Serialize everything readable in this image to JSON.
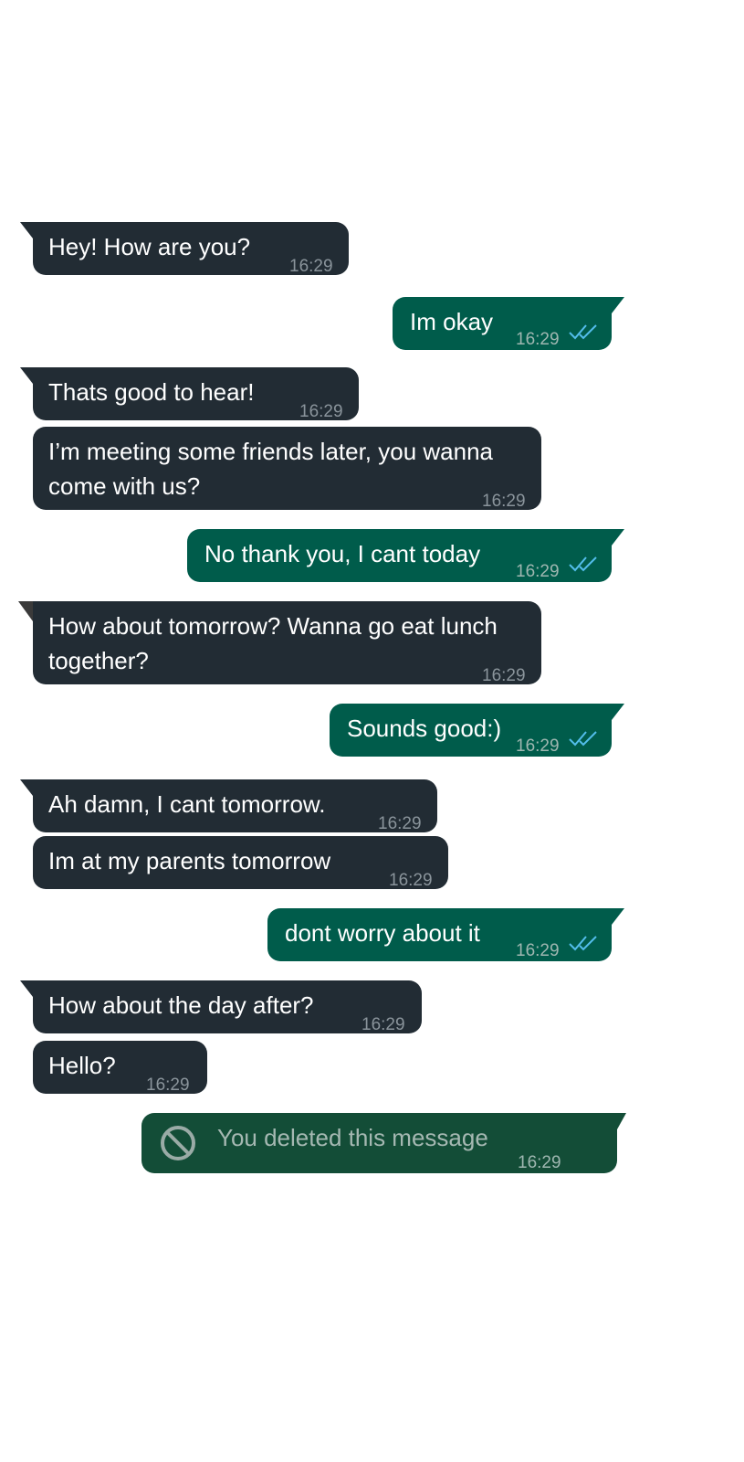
{
  "messages": [
    {
      "id": "m1",
      "direction": "incoming",
      "text": "Hey! How are you?",
      "time": "16:29"
    },
    {
      "id": "m2",
      "direction": "outgoing",
      "text": "Im okay",
      "time": "16:29",
      "status": "read"
    },
    {
      "id": "m3",
      "direction": "incoming",
      "text": "Thats good to hear!",
      "time": "16:29"
    },
    {
      "id": "m4",
      "direction": "incoming",
      "text": "I’m meeting some friends later, you wanna come with us?",
      "time": "16:29"
    },
    {
      "id": "m5",
      "direction": "outgoing",
      "text": "No thank you, I cant today",
      "time": "16:29",
      "status": "read"
    },
    {
      "id": "m6",
      "direction": "incoming",
      "text": "How about tomorrow? Wanna go eat lunch together?",
      "time": "16:29"
    },
    {
      "id": "m7",
      "direction": "outgoing",
      "text": "Sounds good:)",
      "time": "16:29",
      "status": "read"
    },
    {
      "id": "m8",
      "direction": "incoming",
      "text": "Ah damn, I cant tomorrow.",
      "time": "16:29"
    },
    {
      "id": "m9",
      "direction": "incoming",
      "text": "Im at my parents tomorrow",
      "time": "16:29"
    },
    {
      "id": "m10",
      "direction": "outgoing",
      "text": "dont worry about it",
      "time": "16:29",
      "status": "read"
    },
    {
      "id": "m11",
      "direction": "incoming",
      "text": "How about the day after?",
      "time": "16:29"
    },
    {
      "id": "m12",
      "direction": "incoming",
      "text": "Hello?",
      "time": "16:29"
    },
    {
      "id": "m13",
      "direction": "outgoing",
      "text": "You deleted this message",
      "time": "16:29",
      "status": "deleted"
    }
  ],
  "colors": {
    "incoming_bubble": "#222c34",
    "outgoing_bubble": "#005c4b",
    "deleted_bubble": "#134d37",
    "read_ticks": "#53bdeb",
    "timestamp": "#8a949b"
  },
  "icons": {
    "read_receipt": "double-check-icon",
    "deleted": "prohibited-icon"
  }
}
